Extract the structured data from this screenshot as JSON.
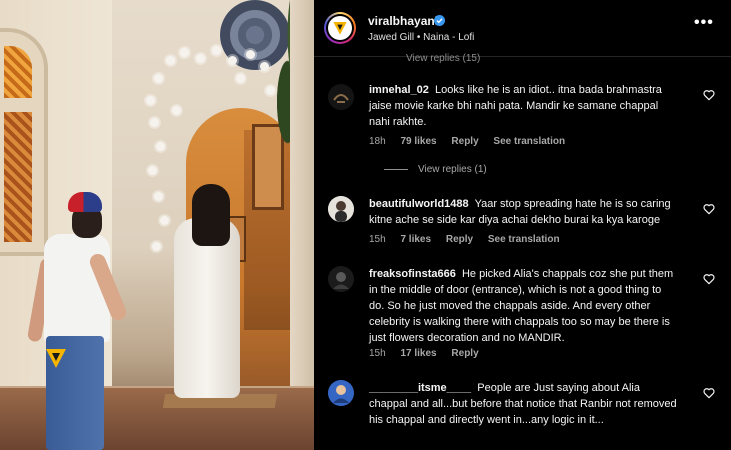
{
  "post": {
    "username": "viralbhayani",
    "audio": "Jawed Gill • Naina - Lofi",
    "more_label": "•••",
    "cut_off_replies": "View replies (15)"
  },
  "icons": {
    "verified": "verified-badge-icon",
    "heart": "heart-outline-icon",
    "more": "more-options-icon"
  },
  "colors": {
    "background": "#000000",
    "meta_text": "#a8a8a8",
    "verified_blue": "#3897f0"
  },
  "comments": [
    {
      "username": "imnehal_02",
      "text": "Looks like he is an idiot.. itna bada brahmastra jaise movie karke bhi nahi pata. Mandir ke samane chappal nahi rakhte.",
      "time": "18h",
      "likes": "79 likes",
      "reply": "Reply",
      "translate": "See translation",
      "view_replies": "View replies (1)"
    },
    {
      "username": "beautifulworld1488",
      "text": "Yaar stop spreading hate he is so caring kitne ache se side kar diya achai dekho burai ka kya karoge",
      "time": "15h",
      "likes": "7 likes",
      "reply": "Reply",
      "translate": "See translation"
    },
    {
      "username": "freaksofinsta666",
      "text": "He picked Alia's chappals coz she put them in the middle of door (entrance), which is not a good thing to do. So he just moved the chappals aside. And every other celebrity is walking there with chappals too so may be there is just flowers decoration and no MANDIR.",
      "time": "15h",
      "likes": "17 likes",
      "reply": "Reply"
    },
    {
      "username": "________itsme____",
      "text": "People are Just saying about Alia chappal and all...but before that notice that Ranbir not removed his chappal and directly went in...any logic in it..."
    }
  ]
}
